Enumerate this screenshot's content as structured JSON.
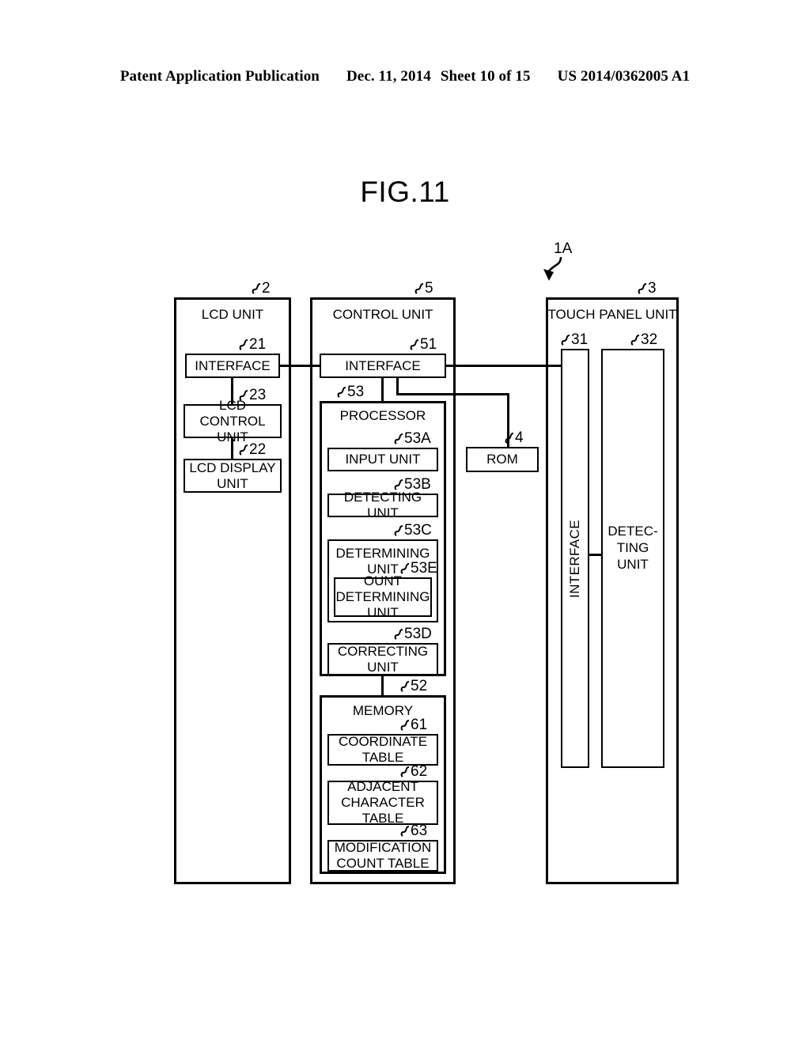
{
  "header": {
    "publication": "Patent Application Publication",
    "date": "Dec. 11, 2014",
    "sheet": "Sheet 10 of 15",
    "docnum": "US 2014/0362005 A1"
  },
  "figure": {
    "title": "FIG.11",
    "system_ref": "1A"
  },
  "diagram": {
    "lcd_unit": {
      "title": "LCD UNIT",
      "ref": "2",
      "blocks": [
        {
          "label": "INTERFACE",
          "ref": "21"
        },
        {
          "label": "LCD CONTROL UNIT",
          "ref": "23"
        },
        {
          "label": "LCD DISPLAY UNIT",
          "ref": "22"
        }
      ]
    },
    "control_unit": {
      "title": "CONTROL UNIT",
      "ref": "5",
      "interface": {
        "label": "INTERFACE",
        "ref": "51"
      },
      "processor": {
        "title": "PROCESSOR",
        "ref": "53",
        "blocks": [
          {
            "label": "INPUT UNIT",
            "ref": "53A"
          },
          {
            "label": "DETECTING UNIT",
            "ref": "53B"
          },
          {
            "label": "DETERMINING UNIT",
            "ref": "53C"
          },
          {
            "label": "OUNT DETERMINING UNIT",
            "ref": "53E"
          },
          {
            "label": "CORRECTING UNIT",
            "ref": "53D"
          }
        ]
      },
      "memory": {
        "title": "MEMORY",
        "ref": "52",
        "blocks": [
          {
            "label": "COORDINATE TABLE",
            "ref": "61"
          },
          {
            "label": "ADJACENT CHARACTER TABLE",
            "ref": "62"
          },
          {
            "label": "MODIFICATION COUNT TABLE",
            "ref": "63"
          }
        ]
      }
    },
    "rom": {
      "label": "ROM",
      "ref": "4"
    },
    "touch_panel_unit": {
      "title": "TOUCH PANEL UNIT",
      "ref": "3",
      "blocks": [
        {
          "label": "INTERFACE",
          "ref": "31"
        },
        {
          "label": "DETEC-TING UNIT",
          "ref": "32"
        }
      ]
    }
  }
}
